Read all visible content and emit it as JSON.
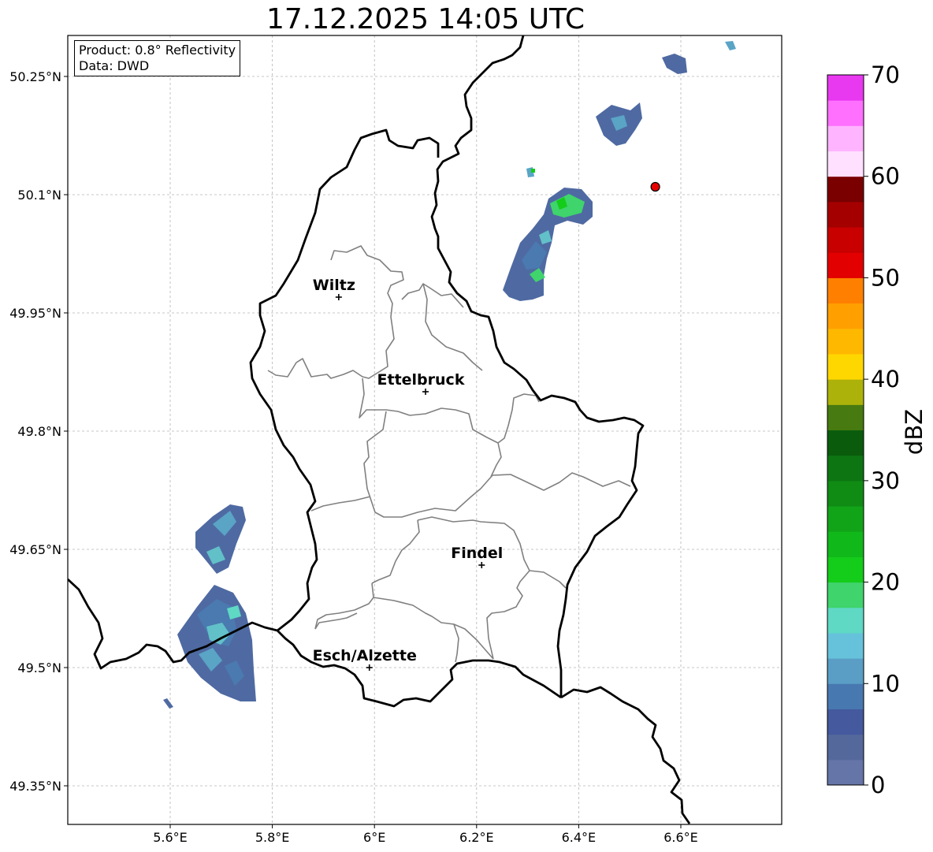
{
  "title": "17.12.2025 14:05 UTC",
  "info": {
    "product": "Product: 0.8° Reflectivity",
    "source": "Data: DWD"
  },
  "axes": {
    "lat_ticks": [
      "49.35°N",
      "49.5°N",
      "49.65°N",
      "49.8°N",
      "49.95°N",
      "50.1°N",
      "50.25°N"
    ],
    "lon_ticks": [
      "5.6°E",
      "5.8°E",
      "6°E",
      "6.2°E",
      "6.4°E",
      "6.6°E"
    ],
    "grid": true,
    "extent": {
      "lon_min": 5.4,
      "lon_max": 6.8,
      "lat_min": 49.3,
      "lat_max": 50.3
    }
  },
  "cities": [
    {
      "name": "Wiltz",
      "lon": 5.93,
      "lat": 49.97
    },
    {
      "name": "Ettelbruck",
      "lon": 6.1,
      "lat": 49.85
    },
    {
      "name": "Findel",
      "lon": 6.21,
      "lat": 49.63
    },
    {
      "name": "Esch/Alzette",
      "lon": 5.99,
      "lat": 49.5
    }
  ],
  "radar_site": {
    "lon": 6.55,
    "lat": 50.11,
    "color": "#e60000"
  },
  "colorbar": {
    "label": "dBZ",
    "min": 0,
    "max": 70,
    "step": 2.5,
    "tick_labels": [
      "0",
      "10",
      "20",
      "30",
      "40",
      "50",
      "60",
      "70"
    ],
    "colors": [
      "#6675a8",
      "#55689c",
      "#44599e",
      "#4878b0",
      "#5a9ec6",
      "#66c2da",
      "#5fd8c4",
      "#3fd46c",
      "#14cc1a",
      "#10b81a",
      "#12a418",
      "#108c14",
      "#0d7612",
      "#0a5c0c",
      "#477a10",
      "#adb20a",
      "#ffd700",
      "#ffb800",
      "#ffa000",
      "#ff8000",
      "#e30000",
      "#c80000",
      "#a50000",
      "#7a0000",
      "#ffe0ff",
      "#ffb4ff",
      "#ff70ff",
      "#e838f0"
    ]
  }
}
